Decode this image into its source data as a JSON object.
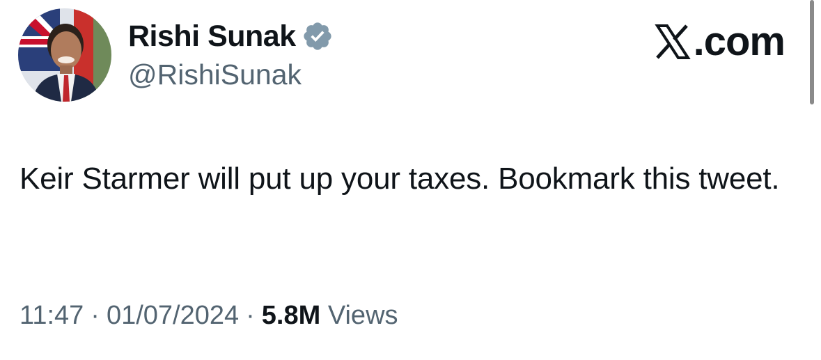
{
  "author": {
    "display_name": "Rishi Sunak",
    "handle": "@RishiSunak",
    "verified_icon": "verified-badge-icon",
    "verified_color": "#829aab"
  },
  "brand": {
    "label": ".com",
    "logo_icon": "x-logo-icon"
  },
  "tweet": {
    "text": "Keir Starmer will put up your taxes. Bookmark this tweet.",
    "time": "11:47",
    "date": "01/07/2024",
    "separator": "·",
    "views_count": "5.8M",
    "views_label": "Views"
  },
  "colors": {
    "text_primary": "#0f1419",
    "text_secondary": "#536471"
  }
}
